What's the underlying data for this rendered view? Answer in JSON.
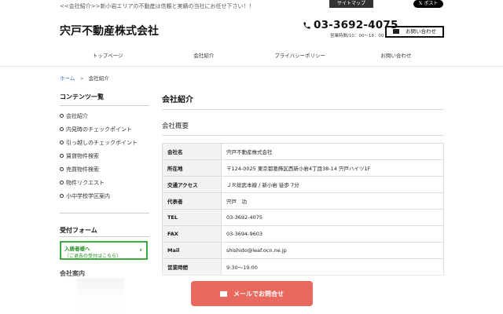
{
  "topbar": {
    "tagline": "<<会社紹介>>新小岩エリアの不動産は信頼と実績の当社にお任せ下さい！！",
    "sitemap_label": "サイトマップ",
    "x_post_label": "ポスト"
  },
  "header": {
    "site_title": "宍戸不動産株式会社",
    "phone": "03-3692-4075",
    "hours": "営業時間/10：00～18：00",
    "contact_label": "お問い合わせ"
  },
  "nav": {
    "items": [
      {
        "label": "トップページ"
      },
      {
        "label": "会社紹介"
      },
      {
        "label": "プライバシーポリシー"
      },
      {
        "label": "お問い合わせ"
      }
    ]
  },
  "breadcrumb": {
    "home": "ホーム",
    "separator": ">",
    "current": "会社紹介"
  },
  "sidebar": {
    "contents_heading": "コンテンツ一覧",
    "items": [
      {
        "label": "会社紹介"
      },
      {
        "label": "内見時のチェックポイント"
      },
      {
        "label": "引っ越しのチェックポイント"
      },
      {
        "label": "賃貸物件検索"
      },
      {
        "label": "売買物件検索"
      },
      {
        "label": "物件リクエスト"
      },
      {
        "label": "小中学校学区案内"
      }
    ],
    "form_heading": "受付フォーム",
    "form_button_line1": "入居者様へ",
    "form_button_line2": "（ご退去の受付はこちら）",
    "company_heading": "会社案内"
  },
  "main": {
    "title": "会社紹介",
    "subtitle": "会社概要",
    "rows": [
      {
        "label": "会社名",
        "value": "宍戸不動産株式会社"
      },
      {
        "label": "所在地",
        "value": "〒124-0025 東京都葛飾区西新小岩4丁目38-14 宍戸ハイツ1F"
      },
      {
        "label": "交通アクセス",
        "value": "ＪＲ総武本線 / 新小岩 徒歩 7分"
      },
      {
        "label": "代表者",
        "value": "宍戸　功"
      },
      {
        "label": "TEL",
        "value": "03-3692-4075"
      },
      {
        "label": "FAX",
        "value": "03-3694-9603"
      },
      {
        "label": "Mail",
        "value": "shishido@leaf.ocn.ne.jp"
      },
      {
        "label": "営業時間",
        "value": "9:30～19:00"
      }
    ]
  },
  "cta": {
    "label": "メールでお問合せ"
  },
  "colors": {
    "accent_green": "#3bab3b",
    "cta_red": "#e8695d",
    "link_blue": "#3a73b8"
  }
}
